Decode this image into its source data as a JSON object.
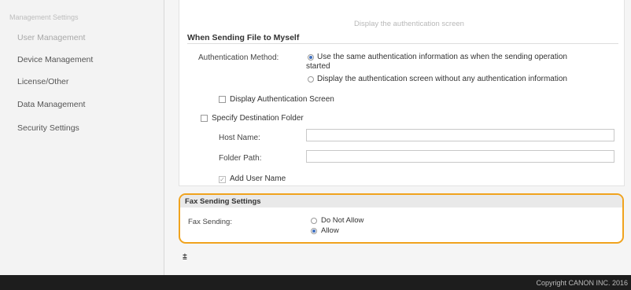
{
  "sidebar": {
    "header": "Management Settings",
    "items": [
      {
        "label": "User Management"
      },
      {
        "label": "Device Management"
      },
      {
        "label": "License/Other"
      },
      {
        "label": "Data Management"
      },
      {
        "label": "Security Settings"
      }
    ]
  },
  "main": {
    "top_ghost_text": "Display the authentication screen",
    "send_to_myself": {
      "title": "When Sending File to Myself",
      "auth_method_label": "Authentication Method:",
      "options": [
        {
          "line1": "Use the same authentication information as when the sending operation",
          "line2": "started",
          "selected": true
        },
        {
          "line1": "Display the authentication screen without any authentication information",
          "selected": false
        }
      ],
      "display_auth_screen_label": "Display Authentication Screen",
      "display_auth_screen_checked": false,
      "specify_dest_folder_label": "Specify Destination Folder",
      "specify_dest_folder_checked": false,
      "host_name_label": "Host Name:",
      "host_name_value": "",
      "folder_path_label": "Folder Path:",
      "folder_path_value": "",
      "add_user_name_label": "Add User Name",
      "add_user_name_checked": true
    },
    "fax_sending": {
      "title": "Fax Sending Settings",
      "label": "Fax Sending:",
      "options": [
        {
          "label": "Do Not Allow",
          "selected": false
        },
        {
          "label": "Allow",
          "selected": true
        }
      ],
      "highlight_color": "#f0a31e"
    },
    "collapse_symbol": "⩲"
  },
  "footer": {
    "copyright": "Copyright CANON INC. 2016"
  }
}
